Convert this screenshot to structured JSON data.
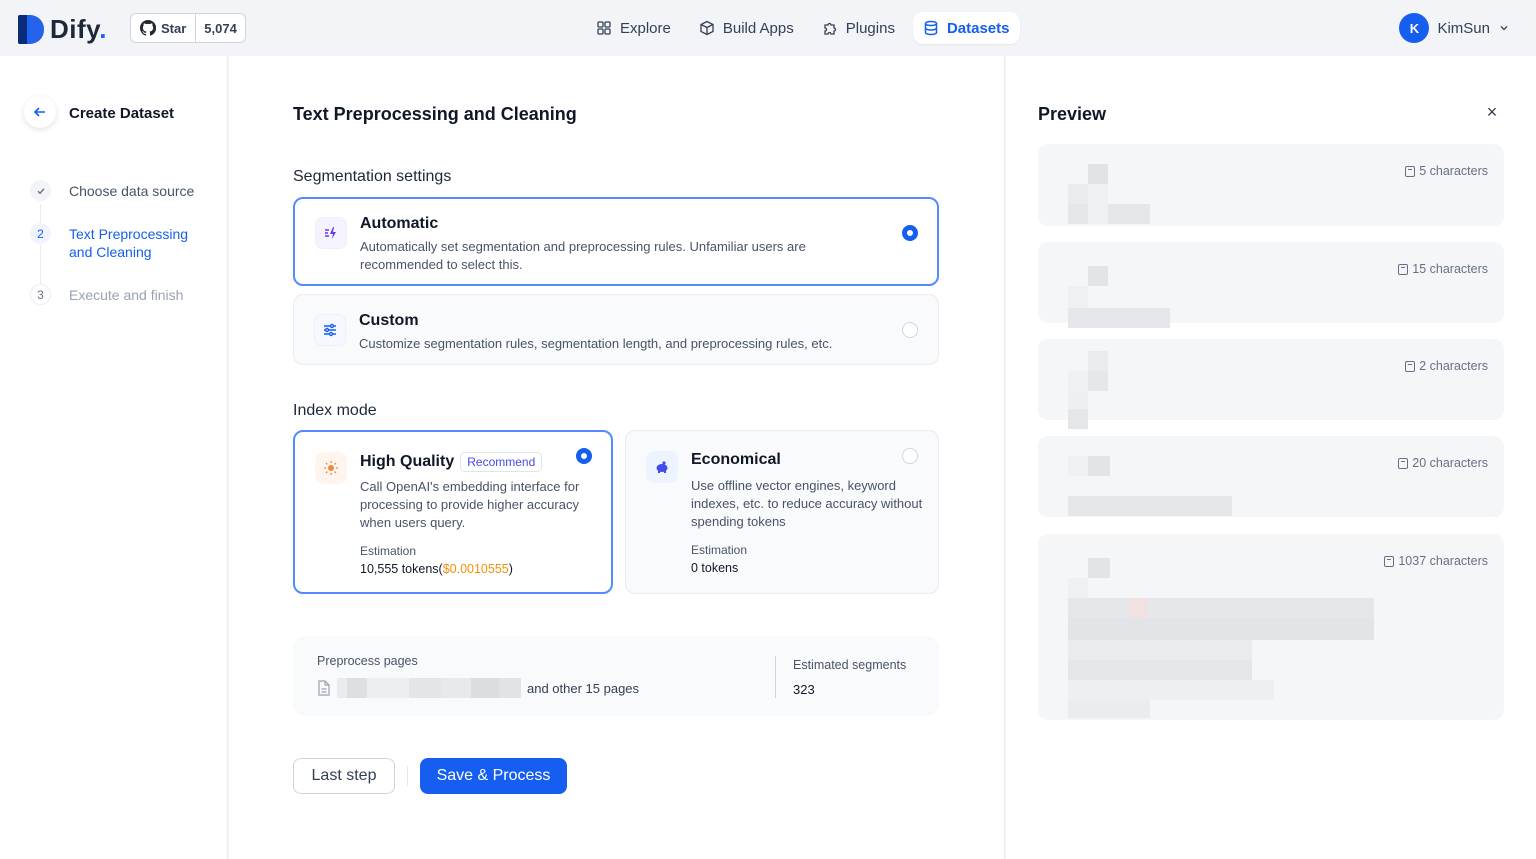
{
  "brand": {
    "name": "Dify",
    "dot": "."
  },
  "github": {
    "star_label": "Star",
    "star_count": "5,074"
  },
  "nav": {
    "items": [
      {
        "label": "Explore",
        "icon": "grid-icon"
      },
      {
        "label": "Build Apps",
        "icon": "cube-icon"
      },
      {
        "label": "Plugins",
        "icon": "puzzle-icon"
      },
      {
        "label": "Datasets",
        "icon": "database-icon",
        "active": true
      }
    ]
  },
  "user": {
    "initial": "K",
    "name": "KimSun"
  },
  "sidebar": {
    "title": "Create Dataset",
    "steps": [
      {
        "num": "✓",
        "label": "Choose data source",
        "state": "done"
      },
      {
        "num": "2",
        "label": "Text Preprocessing and Cleaning",
        "state": "active"
      },
      {
        "num": "3",
        "label": "Execute and finish",
        "state": "pending"
      }
    ]
  },
  "main": {
    "title": "Text Preprocessing and Cleaning",
    "segmentation": {
      "title": "Segmentation settings",
      "options": [
        {
          "title": "Automatic",
          "desc": "Automatically set segmentation and preprocessing rules. Unfamiliar users are recommended to select this.",
          "selected": true
        },
        {
          "title": "Custom",
          "desc": "Customize segmentation rules, segmentation length, and preprocessing rules, etc.",
          "selected": false
        }
      ]
    },
    "index_mode": {
      "title": "Index mode",
      "options": [
        {
          "title": "High Quality",
          "badge": "Recommend",
          "desc": "Call OpenAI's embedding interface for processing to provide higher accuracy when users query.",
          "estimation_label": "Estimation",
          "tokens": "10,555 tokens(",
          "price": "$0.0010555",
          "tokens_close": ")",
          "selected": true
        },
        {
          "title": "Economical",
          "desc": "Use offline vector engines, keyword indexes, etc. to reduce accuracy without spending tokens",
          "estimation_label": "Estimation",
          "tokens": "0 tokens",
          "selected": false
        }
      ]
    },
    "preprocess": {
      "pages_label": "Preprocess pages",
      "other_pages": "and other 15 pages",
      "segments_label": "Estimated segments",
      "segments_value": "323"
    },
    "buttons": {
      "last_step": "Last step",
      "save": "Save & Process"
    }
  },
  "preview": {
    "title": "Preview",
    "close": "×",
    "segments": [
      {
        "chars": "5 characters"
      },
      {
        "chars": "15 characters"
      },
      {
        "chars": "2 characters"
      },
      {
        "chars": "20 characters"
      },
      {
        "chars": "1037 characters"
      }
    ]
  },
  "colors": {
    "accent": "#155eef",
    "price": "#f79009",
    "selected_border": "#528bff"
  }
}
